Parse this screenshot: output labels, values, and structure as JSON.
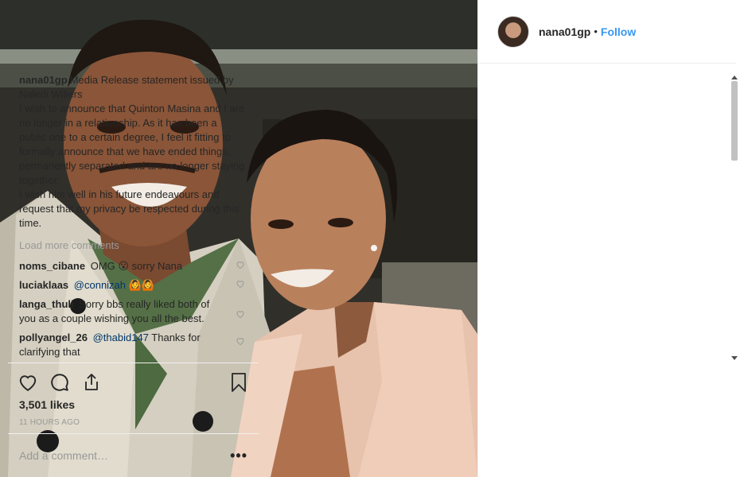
{
  "post": {
    "author": "nana01gp",
    "separator": "•",
    "follow_label": "Follow",
    "caption": {
      "username": "nana01gp",
      "lines": [
        "Media Release statement issued by Naledi Willers",
        "I wish to announce that Quinton Masina and I are no longer in a relationship. As it has been a public one to a certain degree, I feel it fitting to formally announce that we have ended things, permanently separated and are no longer staying together.",
        "I wish him well in his future endeavours and request that my privacy be respected during this time."
      ]
    },
    "load_more_label": "Load more comments",
    "comments": [
      {
        "username": "noms_cibane",
        "text": "OMG 😮 sorry Nana"
      },
      {
        "username": "luciaklaas",
        "mention": "@connizah",
        "text": " 🙆🙆"
      },
      {
        "username": "langa_thuli",
        "text": "Sorry bbs really liked both of you as a couple wishing you all the best."
      },
      {
        "username": "pollyangel_26",
        "mention": "@thabid147",
        "text": " Thanks for clarifying that"
      }
    ],
    "likes": "3,501 likes",
    "time": "11 HOURS AGO",
    "comment_placeholder": "Add a comment…",
    "more_label": "•••"
  },
  "icons": {
    "like": "heart-icon",
    "comment": "comment-icon",
    "share": "share-icon",
    "save": "bookmark-icon"
  },
  "colors": {
    "link": "#3897f0",
    "mention": "#003569",
    "muted": "#999999"
  }
}
